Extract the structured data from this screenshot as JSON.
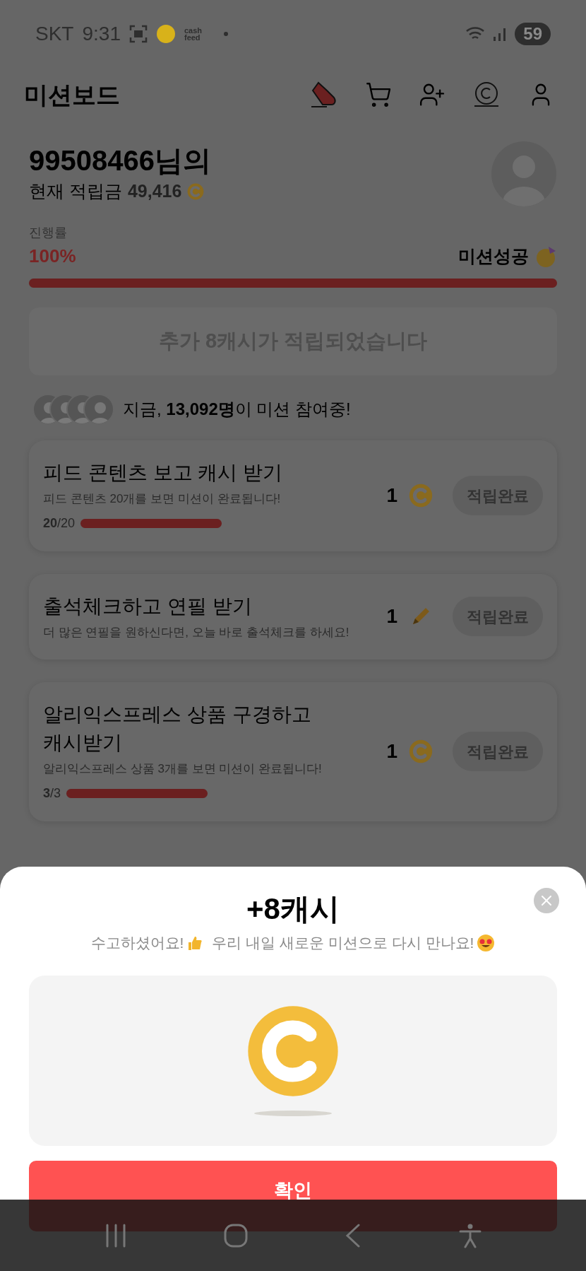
{
  "status_bar": {
    "carrier": "SKT",
    "time": "9:31",
    "app_label": "cash feed",
    "battery": "59"
  },
  "header": {
    "title": "미션보드"
  },
  "profile": {
    "name": "99508466님의",
    "balance_label": "현재 적립금",
    "balance": "49,416"
  },
  "progress": {
    "label": "진행률",
    "percent": "100%",
    "status": "미션성공",
    "level": 1
  },
  "banner": {
    "text": "추가 8캐시가 적립되었습니다"
  },
  "participants": {
    "text": "지금, **13,092명**이 미션 참여중!"
  },
  "missions": [
    {
      "title": "피드 콘텐츠 보고 캐시 받기",
      "description": "피드 콘텐츠 20개를 보면 미션이 완료됩니다!",
      "count": "**20**/20",
      "level": 1,
      "reward": "1",
      "kind": "coin",
      "button": "적립완료"
    },
    {
      "title": "출석체크하고 연필 받기",
      "description": "더 많은 연필을 원하신다면, 오늘 바로 출석체크를 하세요!",
      "reward": "1",
      "kind": "pencil",
      "button": "적립완료"
    },
    {
      "title": "알리익스프레스 상품 구경하고 캐시받기",
      "description": "알리익스프레스 상품 3개를 보면 미션이 완료됩니다!",
      "count": "**3**/3",
      "level": 1,
      "reward": "1",
      "kind": "coin",
      "button": "적립완료"
    }
  ],
  "sheet": {
    "title": "+8캐시",
    "message": [
      "수고하셨어요!",
      "우리 내일 새로운 미션으로 다시 만나요!"
    ],
    "button": "확인"
  }
}
